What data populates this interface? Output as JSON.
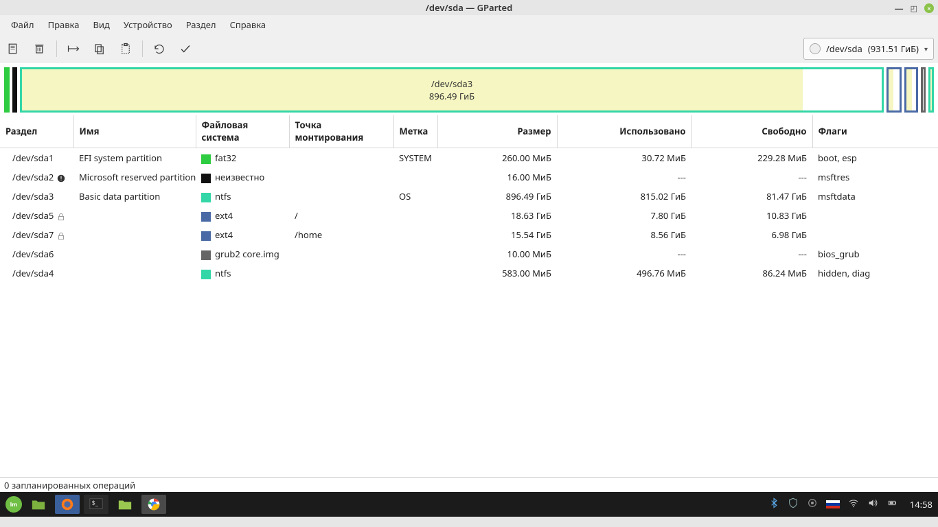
{
  "title": "/dev/sda — GParted",
  "menu": {
    "items": [
      "Файл",
      "Правка",
      "Вид",
      "Устройство",
      "Раздел",
      "Справка"
    ]
  },
  "device_select": {
    "device": "/dev/sda",
    "size": "(931.51 ГиБ)"
  },
  "map": {
    "selected": {
      "dev": "/dev/sda3",
      "size": "896.49 ГиБ"
    }
  },
  "columns": {
    "partition": "Раздел",
    "name": "Имя",
    "fs": "Файловая система",
    "mount": "Точка монтирования",
    "label": "Метка",
    "size": "Размер",
    "used": "Использовано",
    "free": "Свободно",
    "flags": "Флаги"
  },
  "rows": [
    {
      "dev": "/dev/sda1",
      "name": "EFI system partition",
      "fs": "fat32",
      "fs_color": "#2ecc40",
      "mount": "",
      "label": "SYSTEM",
      "size": "260.00 МиБ",
      "used": "30.72 МиБ",
      "free": "229.28 МиБ",
      "flags": "boot, esp",
      "icon": ""
    },
    {
      "dev": "/dev/sda2",
      "name": "Microsoft reserved partition",
      "fs": "неизвестно",
      "fs_color": "#111",
      "mount": "",
      "label": "",
      "size": "16.00 МиБ",
      "used": "---",
      "free": "---",
      "flags": "msftres",
      "icon": "warn"
    },
    {
      "dev": "/dev/sda3",
      "name": "Basic data partition",
      "fs": "ntfs",
      "fs_color": "#32d6a7",
      "mount": "",
      "label": "OS",
      "size": "896.49 ГиБ",
      "used": "815.02 ГиБ",
      "free": "81.47 ГиБ",
      "flags": "msftdata",
      "icon": ""
    },
    {
      "dev": "/dev/sda5",
      "name": "",
      "fs": "ext4",
      "fs_color": "#4a6aa5",
      "mount": "/",
      "label": "",
      "size": "18.63 ГиБ",
      "used": "7.80 ГиБ",
      "free": "10.83 ГиБ",
      "flags": "",
      "icon": "lock"
    },
    {
      "dev": "/dev/sda7",
      "name": "",
      "fs": "ext4",
      "fs_color": "#4a6aa5",
      "mount": "/home",
      "label": "",
      "size": "15.54 ГиБ",
      "used": "8.56 ГиБ",
      "free": "6.98 ГиБ",
      "flags": "",
      "icon": "lock"
    },
    {
      "dev": "/dev/sda6",
      "name": "",
      "fs": "grub2 core.img",
      "fs_color": "#666",
      "mount": "",
      "label": "",
      "size": "10.00 МиБ",
      "used": "---",
      "free": "---",
      "flags": "bios_grub",
      "icon": ""
    },
    {
      "dev": "/dev/sda4",
      "name": "",
      "fs": "ntfs",
      "fs_color": "#32d6a7",
      "mount": "",
      "label": "",
      "size": "583.00 МиБ",
      "used": "496.76 МиБ",
      "free": "86.24 МиБ",
      "flags": "hidden, diag",
      "icon": ""
    }
  ],
  "status": "0 запланированных операций",
  "taskbar": {
    "time": "14:58"
  }
}
